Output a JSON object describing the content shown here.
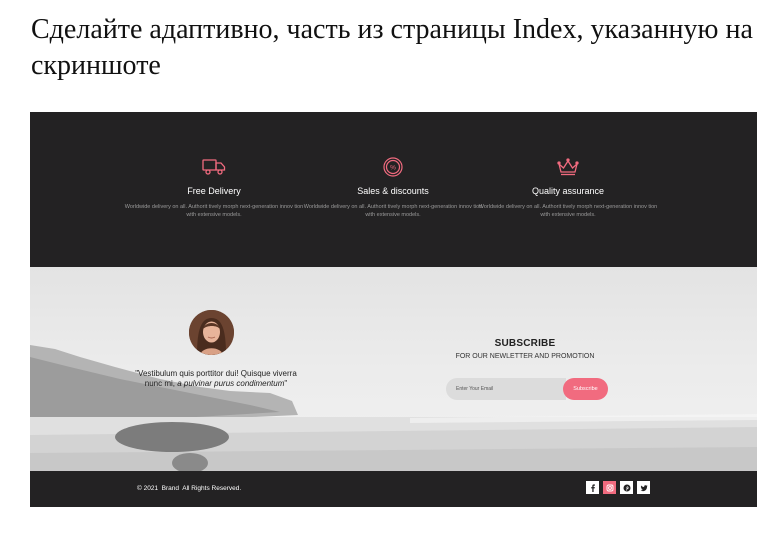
{
  "task": {
    "heading": "Сделайте адаптивно, часть из страницы Index, указанную на скриншоте"
  },
  "colors": {
    "dark": "#232223",
    "accent": "#f16b7f",
    "light": "#ebebeb"
  },
  "features": [
    {
      "icon": "delivery-truck-icon",
      "title": "Free Delivery",
      "text": "Worldwide delivery on all. Authorit tively morph next-generation innov tion with extensive models."
    },
    {
      "icon": "percent-badge-icon",
      "title": "Sales & discounts",
      "text": "Worldwide delivery on all. Authorit tively morph next-generation innov tion with extensive models."
    },
    {
      "icon": "crown-icon",
      "title": "Quality assurance",
      "text": "Worldwide delivery on all. Authorit tively morph next-generation innov tion with extensive models."
    }
  ],
  "testimonial": {
    "quote_plain": "\"Vestibulum quis porttitor dui! Quisque viverra nunc mi, ",
    "quote_italic": "a pulvinar purus condimentum",
    "quote_end": "\""
  },
  "subscribe": {
    "title": "SUBSCRIBE",
    "subtitle": "FOR OUR NEWLETTER AND PROMOTION",
    "placeholder": "Enter Your Email",
    "button": "Subscribe"
  },
  "footer": {
    "copyright": "© 2021  Brand  All Rights Reserved.",
    "socials": [
      "facebook-icon",
      "instagram-icon",
      "pinterest-icon",
      "twitter-icon"
    ]
  }
}
